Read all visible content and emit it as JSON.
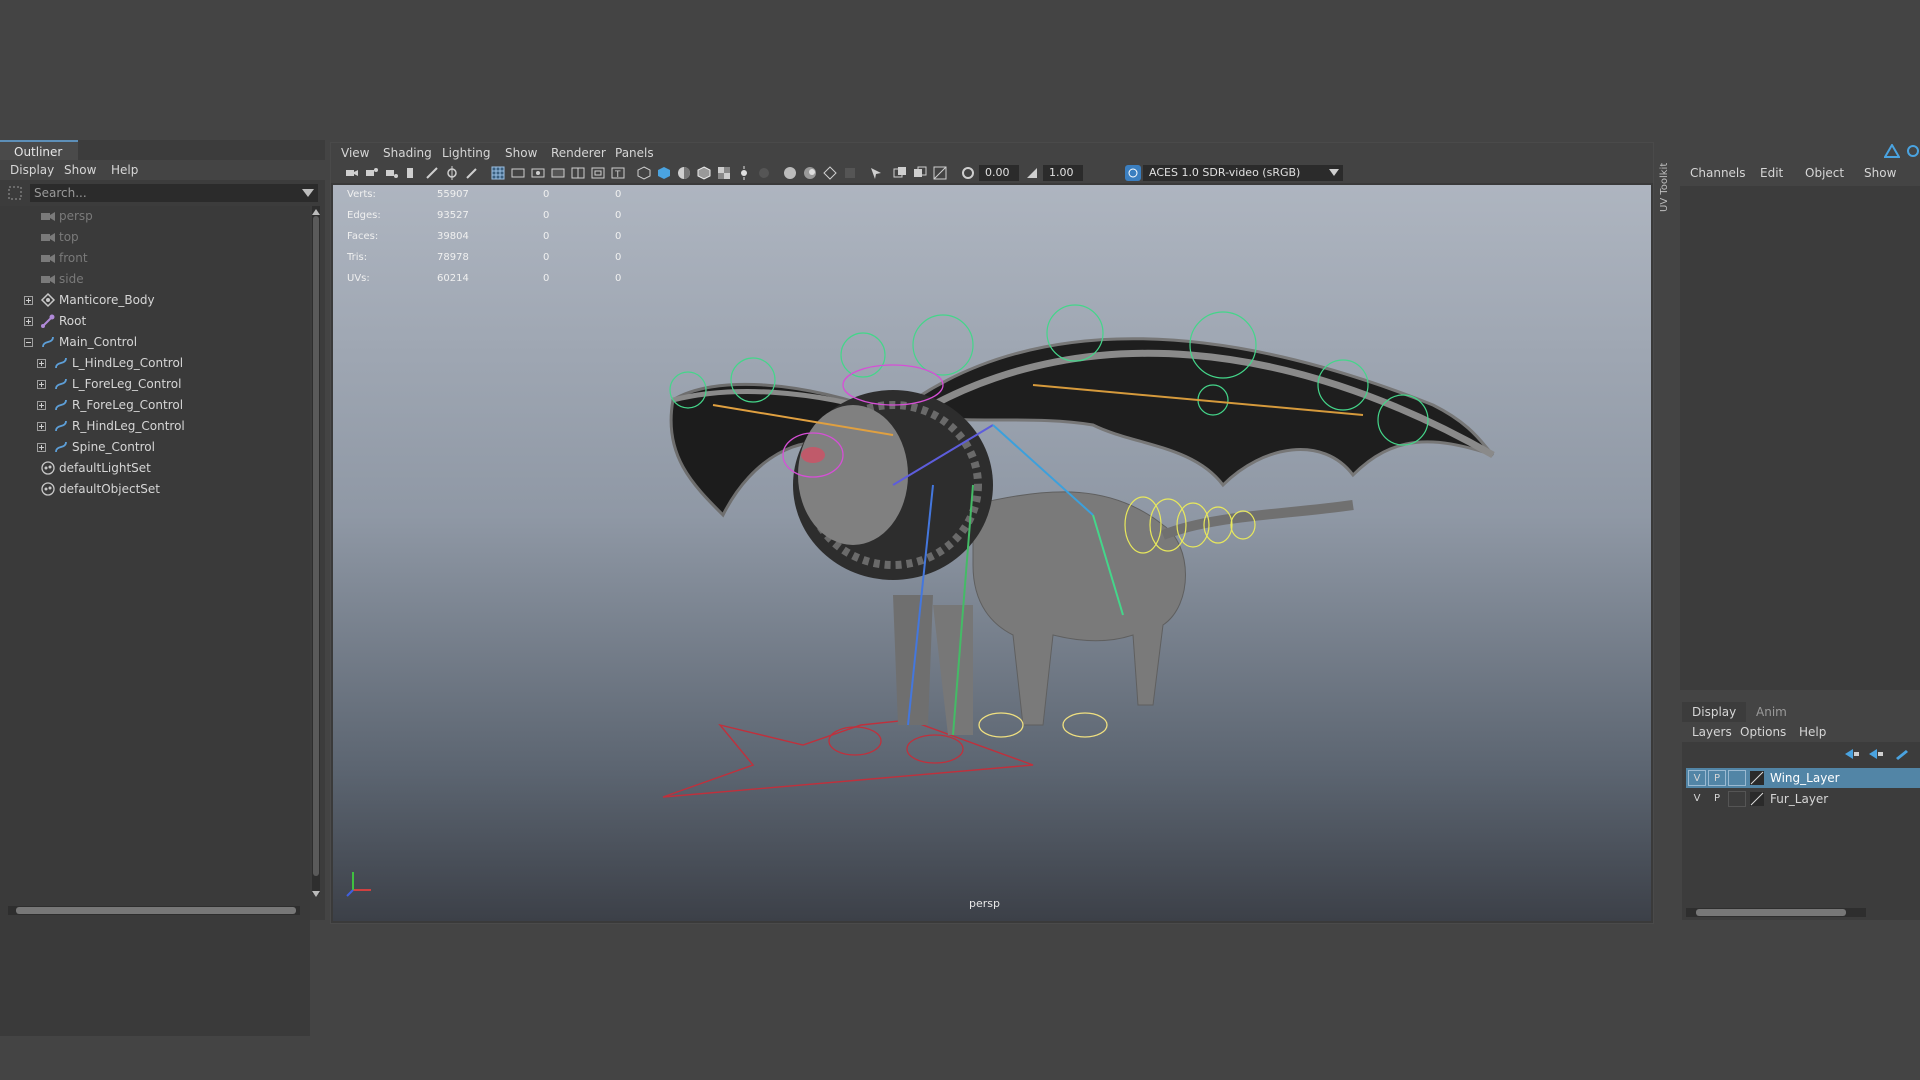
{
  "outliner": {
    "title": "Outliner",
    "menu": [
      "Display",
      "Show",
      "Help"
    ],
    "search_placeholder": "Search...",
    "items": [
      {
        "label": "persp",
        "type": "camera",
        "dim": true
      },
      {
        "label": "top",
        "type": "camera",
        "dim": true
      },
      {
        "label": "front",
        "type": "camera",
        "dim": true
      },
      {
        "label": "side",
        "type": "camera",
        "dim": true
      },
      {
        "label": "Manticore_Body",
        "type": "mesh"
      },
      {
        "label": "Root",
        "type": "joint"
      },
      {
        "label": "Main_Control",
        "type": "curve",
        "expanded": true
      },
      {
        "label": "L_HindLeg_Control",
        "type": "curve",
        "child": true
      },
      {
        "label": "L_ForeLeg_Control",
        "type": "curve",
        "child": true
      },
      {
        "label": "R_ForeLeg_Control",
        "type": "curve",
        "child": true
      },
      {
        "label": "R_HindLeg_Control",
        "type": "curve",
        "child": true
      },
      {
        "label": "Spine_Control",
        "type": "curve",
        "child": true
      },
      {
        "label": "defaultLightSet",
        "type": "set"
      },
      {
        "label": "defaultObjectSet",
        "type": "set"
      }
    ]
  },
  "viewport": {
    "menu": [
      "View",
      "Shading",
      "Lighting",
      "Show",
      "Renderer",
      "Panels"
    ],
    "exposure": "0.00",
    "gamma": "1.00",
    "color_space": "ACES 1.0 SDR-video (sRGB)",
    "camera_label": "persp",
    "stats": [
      {
        "label": "Verts:",
        "value": "55907",
        "a": "0",
        "b": "0"
      },
      {
        "label": "Edges:",
        "value": "93527",
        "a": "0",
        "b": "0"
      },
      {
        "label": "Faces:",
        "value": "39804",
        "a": "0",
        "b": "0"
      },
      {
        "label": "Tris:",
        "value": "78978",
        "a": "0",
        "b": "0"
      },
      {
        "label": "UVs:",
        "value": "60214",
        "a": "0",
        "b": "0"
      }
    ]
  },
  "side_strip": {
    "label": "UV Toolkit"
  },
  "channel_box": {
    "menu": [
      "Channels",
      "Edit",
      "Object",
      "Show"
    ]
  },
  "layer_editor": {
    "tabs": [
      "Display",
      "Anim"
    ],
    "menu": [
      "Layers",
      "Options",
      "Help"
    ],
    "layers": [
      {
        "v": "V",
        "p": "P",
        "name": "Wing_Layer",
        "selected": true
      },
      {
        "v": "V",
        "p": "P",
        "name": "Fur_Layer",
        "selected": false
      }
    ]
  },
  "colors": {
    "selection": "#5285a6",
    "accent_blue": "#5d8fb8",
    "control_curve_green": "#44d68a",
    "control_curve_red": "#c0303c"
  }
}
